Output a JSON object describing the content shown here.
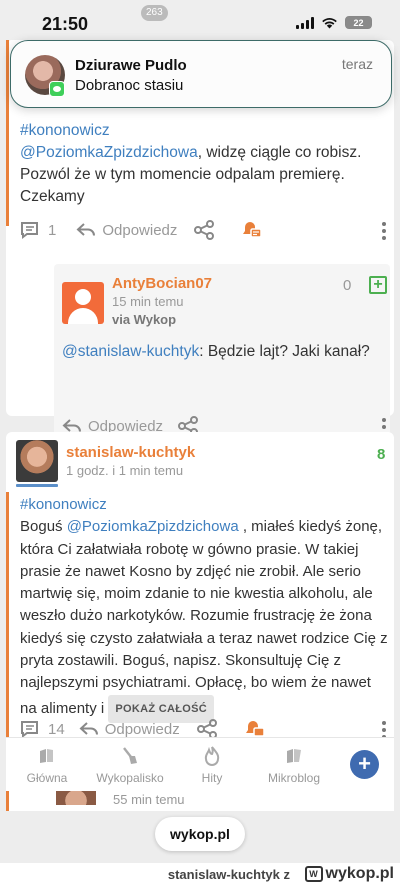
{
  "status_bar": {
    "time": "21:50",
    "battery": "22"
  },
  "notification": {
    "sender": "Dziurawe Pudlo",
    "message": "Dobranoc stasiu",
    "time": "teraz"
  },
  "post1": {
    "tag": "#kononowicz",
    "mention": "@PoziomkaZpizdzichowa",
    "text_after_mention": ", widzę ciągle co robisz.",
    "line2": "Pozwól że w tym momencie odpalam premierę.",
    "line3": "Czekamy",
    "comment_count": "1",
    "reply_label": "Odpowiedz"
  },
  "reply": {
    "username": "AntyBocian07",
    "time": "15 min temu",
    "via": "via Wykop",
    "votes": "0",
    "mention": "@stanislaw-kuchtyk",
    "text": ": Będzie lajt? Jaki kanał?",
    "reply_label": "Odpowiedz"
  },
  "post2": {
    "username": "stanislaw-kuchtyk",
    "time": "1 godz. i 1 min temu",
    "votes": "8",
    "tag": "#kononowicz",
    "line1_pre": "Boguś ",
    "mention": "@PoziomkaZpizdzichowa",
    "line1_post": " , miałeś kiedyś żonę,",
    "lines": [
      "która Ci załatwiała robotę w gówno prasie. W takiej",
      "prasie że nawet Kosno by zdjęć nie zrobił. Ale serio",
      "martwię się, moim zdanie to nie kwestia alkoholu, ale",
      "weszło dużo narkotyków. Rozumie frustrację że żona",
      "kiedyś się czysto załatwiała a teraz nawet rodzice Cię z",
      "pryta zostawili. Boguś, napisz. Skonsultuję Cię z",
      "najlepszymi psychiatrami. Opłacę, bo wiem że nawet"
    ],
    "last_line": "na alimenty i",
    "show_all": "POKAŻ CAŁOŚĆ",
    "comment_count": "14",
    "reply_label": "Odpowiedz"
  },
  "bottom_nav": {
    "items": [
      {
        "label": "Główna",
        "icon": "home-icon"
      },
      {
        "label": "Wykopalisko",
        "icon": "shovel-icon"
      },
      {
        "label": "Hity",
        "icon": "flame-icon"
      },
      {
        "label": "Mikroblog",
        "icon": "mikroblog-icon"
      }
    ],
    "badge": "263",
    "add_icon": "plus-icon"
  },
  "peek": {
    "time": "55 min temu"
  },
  "browser": {
    "url": "wykop.pl"
  },
  "footer": {
    "username": "stanislaw-kuchtyk",
    "suffix": "z",
    "logo": "wykop.pl"
  },
  "colors": {
    "accent_orange": "#e9803a",
    "link_blue": "#3f7fbf",
    "vote_green": "#4caf50",
    "nav_blue": "#3f6bb0"
  }
}
